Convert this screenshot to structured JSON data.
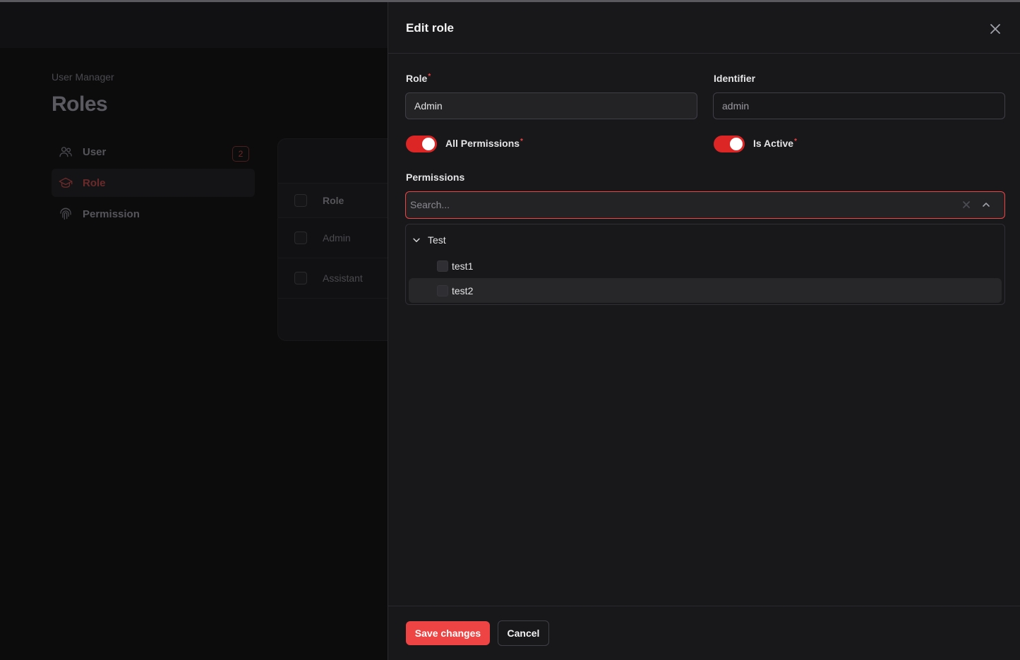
{
  "background": {
    "breadcrumb": "User Manager",
    "page_title": "Roles",
    "nav": [
      {
        "label": "User",
        "icon": "users-icon",
        "badge": "2"
      },
      {
        "label": "Role",
        "icon": "graduation-cap-icon",
        "active": true
      },
      {
        "label": "Permission",
        "icon": "fingerprint-icon"
      }
    ],
    "table": {
      "header": "Role",
      "rows": [
        "Admin",
        "Assistant"
      ]
    }
  },
  "drawer": {
    "title": "Edit role",
    "role_label": "Role",
    "role_value": "Admin",
    "identifier_label": "Identifier",
    "identifier_value": "admin",
    "all_permissions_label": "All Permissions",
    "all_permissions_on": true,
    "is_active_label": "Is Active",
    "is_active_on": true,
    "required_mark": "*",
    "permissions_label": "Permissions",
    "search_placeholder": "Search...",
    "tree": {
      "group": "Test",
      "items": [
        "test1",
        "test2"
      ]
    },
    "save_label": "Save changes",
    "cancel_label": "Cancel"
  },
  "colors": {
    "accent": "#ef4444",
    "toggle_on": "#dc2626",
    "panel": "#18181b"
  }
}
